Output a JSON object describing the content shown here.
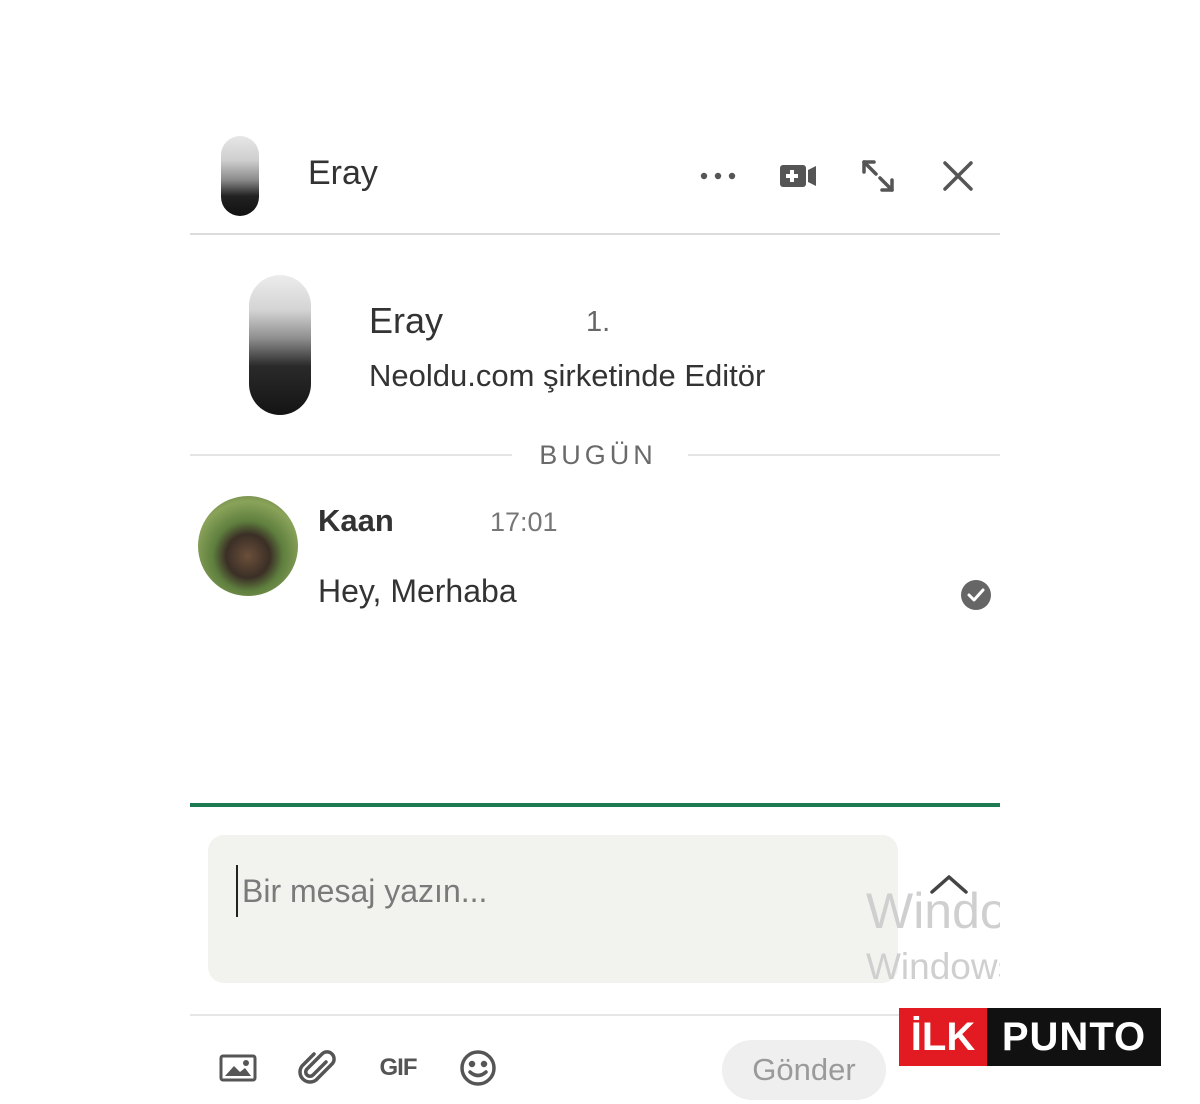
{
  "header": {
    "contact_name": "Eray",
    "icons": [
      "more-icon",
      "video-call-icon",
      "expand-icon",
      "close-icon"
    ]
  },
  "profile": {
    "name": "Eray",
    "degree": "1.",
    "headline": "Neoldu.com şirketinde Editör"
  },
  "day_divider": "BUGÜN",
  "messages": [
    {
      "sender": "Kaan",
      "time": "17:01",
      "text": "Hey, Merhaba",
      "status_icon": "read-check-icon"
    }
  ],
  "composer": {
    "placeholder": "Bir mesaj yazın...",
    "tools": [
      "image-icon",
      "attachment-icon",
      "gif-icon",
      "emoji-icon"
    ],
    "gif_label": "GIF",
    "send_label": "Gönder"
  },
  "watermark": {
    "line1": "Windows",
    "line2": "Windows"
  },
  "brand_logo": {
    "part1": "İLK",
    "part2": "PUNTO"
  },
  "colors": {
    "accent_green": "#1e7a52",
    "logo_red": "#e21b23"
  }
}
